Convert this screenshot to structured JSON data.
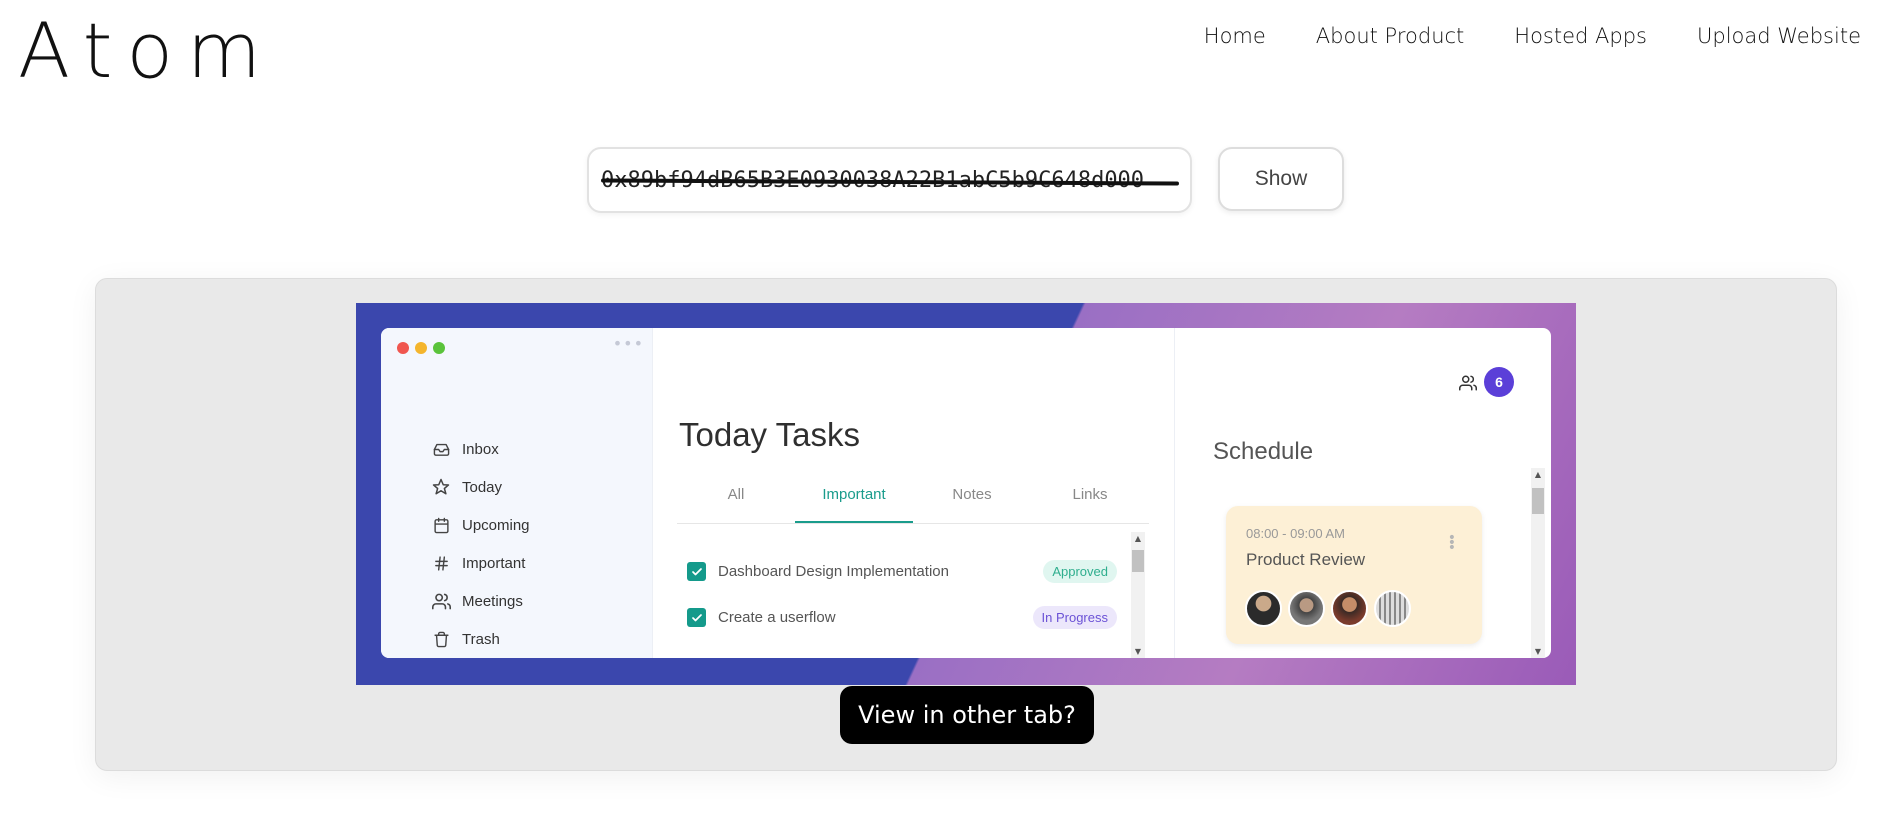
{
  "header": {
    "logo": "Atom",
    "nav": [
      "Home",
      "About Product",
      "Hosted Apps",
      "Upload Website"
    ]
  },
  "search": {
    "value": "0x89bf94dB65B3E0930038A22B1abC5b9C648d000",
    "show_label": "Show"
  },
  "preview": {
    "sidebar": {
      "items": [
        {
          "label": "Inbox",
          "icon": "inbox-icon"
        },
        {
          "label": "Today",
          "icon": "star-icon"
        },
        {
          "label": "Upcoming",
          "icon": "calendar-icon"
        },
        {
          "label": "Important",
          "icon": "hash-icon"
        },
        {
          "label": "Meetings",
          "icon": "users-icon"
        },
        {
          "label": "Trash",
          "icon": "trash-icon"
        }
      ]
    },
    "tasks": {
      "title": "Today Tasks",
      "tabs": [
        "All",
        "Important",
        "Notes",
        "Links"
      ],
      "active_tab": "Important",
      "items": [
        {
          "title": "Dashboard Design Implementation",
          "status": "Approved"
        },
        {
          "title": "Create a userflow",
          "status": "In Progress"
        }
      ]
    },
    "schedule": {
      "title": "Schedule",
      "member_count": "6",
      "event": {
        "time": "08:00 - 09:00 AM",
        "title": "Product Review"
      }
    },
    "colors": {
      "teal": "#149a8b",
      "purple": "#5b3fd8",
      "approved_bg": "#e0f6f0",
      "inprogress_bg": "#ece7fb"
    }
  },
  "view_button": "View in other tab?"
}
